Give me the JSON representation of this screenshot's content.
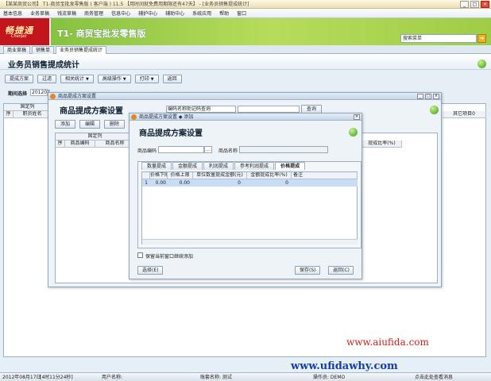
{
  "window": {
    "title": "【某某商贸公司】 T1-商贸宝批发零售版 ( 客户端 ) 11.5 【用时间就免费用期限还有47天】 - [业务员销售提成统计]"
  },
  "menu": [
    "基本信息",
    "业务草稿",
    "钱流草稿",
    "商务管理",
    "信息中心",
    "辅护中心",
    "辅助中心",
    "系统应用",
    "帮助",
    "窗口"
  ],
  "banner": {
    "logo": "畅捷通",
    "logo_sub": "Chanjet",
    "product": "T1- 商贸宝批发零售版",
    "search_placeholder": "搜索菜单"
  },
  "tabs": [
    "商业草稿",
    "销售单",
    "业务员销售提成统计"
  ],
  "page": {
    "title": "业务员销售提成统计",
    "toolbar": [
      "提成方案",
      "过滤",
      "相关统计",
      "高级操作",
      "打印",
      "返回"
    ],
    "period_label": "期间选择",
    "period_value": "201207"
  },
  "grid": {
    "col_fixed": "固定列",
    "col_index": "序",
    "col_name": "职员姓名",
    "col_right": "其它项目0"
  },
  "window1": {
    "title": "商品提成方案设置",
    "heading": "商品提成方案设置",
    "search_combo": "编码名称助记码查询",
    "query_btn": "查询",
    "toolbar": [
      "添加",
      "编辑",
      "删除"
    ],
    "col_fixed": "固定列",
    "col_index": "序",
    "col_code": "商品编码",
    "col_name": "商品名称",
    "col_rate": "提成比率(%)"
  },
  "window2": {
    "title": "商品提成方案设置 ◆ 添加",
    "heading": "商品提成方案设置",
    "code_label": "商品编码",
    "code_btn": "...",
    "name_label": "商品名称",
    "ptabs": [
      "数量提成",
      "金额提成",
      "利润提成",
      "参考利润提成",
      "价格提成"
    ],
    "headers": [
      "价格下限",
      "价格上限",
      "单位数量提成金额(元)",
      "金额提成比率(%)",
      "备注"
    ],
    "row": {
      "index": "1",
      "lower": "0.00",
      "upper": "0.00",
      "unit_amount": "0",
      "rate": "0"
    },
    "checkbox_label": "保留当前窗口继续添加",
    "help_btn": "选择(E)",
    "save_btn": "保存(S)",
    "return_btn": "返回(C)"
  },
  "status": {
    "date": "2012年08月17日",
    "time": "[4时11分24秒]",
    "user": "用户名称:",
    "staff": "账套名称: 测试",
    "operator": "操作员: DEMO",
    "hint": "点击此处查看消息"
  },
  "watermarks": [
    "www.aiufida.com",
    "www.ufidawhy.com"
  ]
}
